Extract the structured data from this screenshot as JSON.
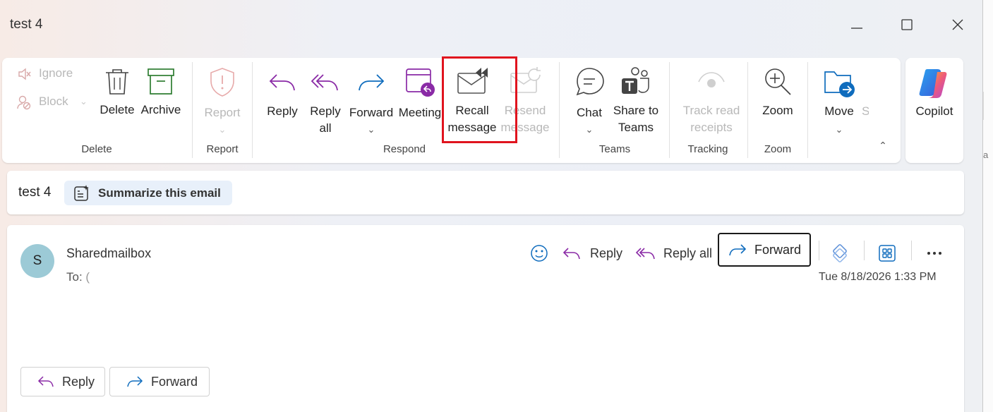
{
  "window": {
    "title": "test 4"
  },
  "colors": {
    "accent": "#0f6cbd",
    "purple": "#8a2aa6",
    "highlight": "#e0141e",
    "avatar_bg": "#9ccad6"
  },
  "ribbon": {
    "delete_group": {
      "label": "Delete",
      "ignore": "Ignore",
      "block": "Block",
      "delete": "Delete",
      "archive": "Archive"
    },
    "report_group": {
      "label": "Report",
      "report": "Report"
    },
    "respond_group": {
      "label": "Respond",
      "reply": "Reply",
      "reply_all_1": "Reply",
      "reply_all_2": "all",
      "forward": "Forward",
      "meeting": "Meeting",
      "recall_1": "Recall",
      "recall_2": "message",
      "resend_1": "Resend",
      "resend_2": "message"
    },
    "teams_group": {
      "label": "Teams",
      "chat": "Chat",
      "share_1": "Share to",
      "share_2": "Teams"
    },
    "tracking_group": {
      "label": "Tracking",
      "track_1": "Track read",
      "track_2": "receipts"
    },
    "zoom_group": {
      "label": "Zoom",
      "zoom": "Zoom"
    },
    "move": {
      "label": "Move",
      "cut_next": "S"
    },
    "copilot": "Copilot"
  },
  "subject": {
    "title": "test 4",
    "summarize": "Summarize this email"
  },
  "message": {
    "avatar_initial": "S",
    "sender": "Sharedmailbox",
    "to_label": "To:",
    "to_cut": "(",
    "date": "Tue 8/18/2026 1:33 PM",
    "actions": {
      "reply": "Reply",
      "reply_all": "Reply all",
      "forward": "Forward"
    },
    "bottom": {
      "reply": "Reply",
      "forward": "Forward"
    }
  },
  "right_strip": {
    "frag_1": "a"
  }
}
